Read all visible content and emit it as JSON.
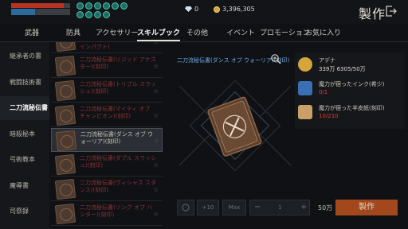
{
  "header": {
    "title": "製作",
    "currencies": [
      {
        "icon": "diamond-icon",
        "value": "0"
      },
      {
        "icon": "adena-coin-icon",
        "value": "3,396,305"
      }
    ],
    "buff_icons": [
      "buff-icon",
      "buff-icon",
      "buff-icon",
      "buff-icon",
      "buff-icon",
      "buff-icon",
      "buff-icon",
      "buff-icon",
      "buff-icon",
      "buff-icon"
    ]
  },
  "tabs": [
    {
      "label": "武器"
    },
    {
      "label": "防具"
    },
    {
      "label": "アクセサリー"
    },
    {
      "label": "スキルブック",
      "active": true
    },
    {
      "label": "その他"
    },
    {
      "label": "イベント"
    },
    {
      "label": "プロモーション"
    },
    {
      "label": "お気に入り"
    }
  ],
  "sidebar": [
    {
      "label": "継承者の書"
    },
    {
      "label": "戦闘技術書"
    },
    {
      "label": "二刀流秘伝書",
      "active": true
    },
    {
      "label": "暗殺秘本"
    },
    {
      "label": "弓術教本"
    },
    {
      "label": "魔導書"
    },
    {
      "label": "司祭録"
    }
  ],
  "books": [
    {
      "name": "インパクト)"
    },
    {
      "name": "二刀流秘伝書(リジッド アナスター)(刻印)"
    },
    {
      "name": "二刀流秘伝書(トリプル スラッシュ)(刻印)"
    },
    {
      "name": "二刀流秘伝書(マイティ オブ チャンピオン)(刻印)"
    },
    {
      "name": "二刀流秘伝書(ダンス オブ ウォーリア)(刻印)",
      "selected": true
    },
    {
      "name": "二刀流秘伝書(ダブル スラッシュ)(刻印)"
    },
    {
      "name": "二刀流秘伝書(ヴィシャス スタンス)(刻印)"
    },
    {
      "name": "二刀流秘伝書(ソング オブ ハンター)(刻印)"
    }
  ],
  "detail": {
    "title": "二刀流秘伝書(ダンス オブ ウォーリア)(刻印)"
  },
  "materials": [
    {
      "name": "アデナ",
      "count": "339万 6305/50万",
      "icon": "adena-coin-icon",
      "color": "#d4a53a",
      "status": "enough"
    },
    {
      "name": "魔力が宿ったインク(希少)",
      "count": "0/1",
      "icon": "ink-bottle-icon",
      "color": "#3b6fb5",
      "status": "short"
    },
    {
      "name": "魔力が宿った羊皮紙(刻印)",
      "count": "10/210",
      "icon": "parchment-icon",
      "color": "#c9a067",
      "status": "short"
    }
  ],
  "controls": {
    "plus10": "+10",
    "max": "Max",
    "minus": "−",
    "quantity": "1",
    "plus": "+",
    "cost": "50万",
    "craft": "製作"
  },
  "colors": {
    "accent": "#a2481c",
    "link_blue": "#6fa7e2",
    "shortage_red": "#e23b3b",
    "hp_red": "#b93323",
    "mp_blue": "#2c6b9c"
  }
}
